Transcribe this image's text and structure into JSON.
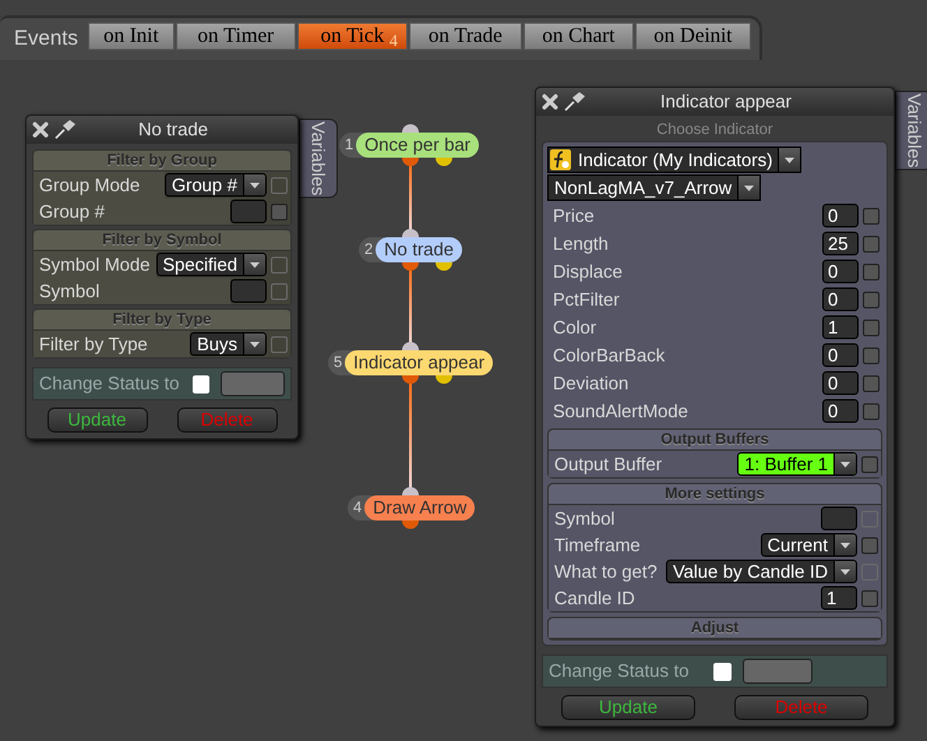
{
  "events": {
    "label": "Events",
    "tabs": [
      {
        "label": "on Init",
        "selected": false
      },
      {
        "label": "on Timer",
        "selected": false
      },
      {
        "label": "on Tick",
        "selected": true,
        "badge": "4"
      },
      {
        "label": "on Trade",
        "selected": false
      },
      {
        "label": "on Chart",
        "selected": false
      },
      {
        "label": "on Deinit",
        "selected": false
      }
    ]
  },
  "nodes": [
    {
      "number": "1",
      "label": "Once per bar",
      "color": "#a8e07c",
      "secondary_output": true
    },
    {
      "number": "2",
      "label": "No trade",
      "color": "#b3cdfb",
      "secondary_output": true
    },
    {
      "number": "5",
      "label": "Indicator appear",
      "color": "#fcd870",
      "secondary_output": true
    },
    {
      "number": "4",
      "label": "Draw Arrow",
      "color": "#f7804f",
      "secondary_output": false
    }
  ],
  "panels": [
    {
      "title": "No trade",
      "side_tab": "Variables",
      "sections": [
        {
          "heading": "Filter by Group",
          "rows": [
            {
              "kind": "select",
              "label": "Group Mode",
              "value": "Group #",
              "toggle_enabled": false
            },
            {
              "kind": "input",
              "label": "Group #",
              "toggle_enabled": true
            }
          ]
        },
        {
          "heading": "Filter by Symbol",
          "rows": [
            {
              "kind": "select",
              "label": "Symbol Mode",
              "value": "Specified",
              "toggle_enabled": false
            },
            {
              "kind": "input",
              "label": "Symbol",
              "toggle_enabled": false
            }
          ]
        },
        {
          "heading": "Filter by Type",
          "rows": [
            {
              "kind": "select",
              "label": "Filter by Type",
              "value": "Buys",
              "toggle_enabled": false
            }
          ]
        }
      ],
      "status": {
        "label": "Change Status to",
        "checked": false
      },
      "buttons": [
        {
          "label": "Update",
          "color": "#3db83d"
        },
        {
          "label": "Delete",
          "color": "#dd0000"
        }
      ]
    },
    {
      "title": "Indicator appear",
      "side_tab": "Variables",
      "chooser": {
        "heading": "Choose Indicator",
        "pickers": [
          {
            "kind": "category",
            "value": "Indicator (My Indicators)"
          },
          {
            "kind": "plain",
            "value": "NonLagMA_v7_Arrow"
          }
        ],
        "rows": [
          {
            "kind": "input",
            "label": "Price",
            "value": "0",
            "toggle_enabled": true
          },
          {
            "kind": "input",
            "label": "Length",
            "value": "25",
            "toggle_enabled": true
          },
          {
            "kind": "input",
            "label": "Displace",
            "value": "0",
            "toggle_enabled": true
          },
          {
            "kind": "input",
            "label": "PctFilter",
            "value": "0",
            "toggle_enabled": true
          },
          {
            "kind": "input",
            "label": "Color",
            "value": "1",
            "toggle_enabled": true
          },
          {
            "kind": "input",
            "label": "ColorBarBack",
            "value": "0",
            "toggle_enabled": true
          },
          {
            "kind": "input",
            "label": "Deviation",
            "value": "0",
            "toggle_enabled": true
          },
          {
            "kind": "input",
            "label": "SoundAlertMode",
            "value": "0",
            "toggle_enabled": true
          }
        ]
      },
      "sections": [
        {
          "heading": "Output Buffers",
          "rows": [
            {
              "kind": "select",
              "label": "Output Buffer",
              "value": "1: Buffer 1",
              "highlighted": true,
              "toggle_enabled": true
            }
          ]
        },
        {
          "heading": "More settings",
          "rows": [
            {
              "kind": "input",
              "label": "Symbol",
              "toggle_enabled": false
            },
            {
              "kind": "select",
              "label": "Timeframe",
              "value": "Current",
              "toggle_enabled": true
            },
            {
              "kind": "select",
              "label": "What to get?",
              "value": "Value by Candle ID",
              "toggle_enabled": false
            },
            {
              "kind": "input",
              "label": "Candle ID",
              "value": "1",
              "toggle_enabled": true
            }
          ]
        },
        {
          "heading": "Adjust"
        }
      ],
      "status": {
        "label": "Change Status to",
        "checked": false
      },
      "buttons": [
        {
          "label": "Update",
          "color": "#3db83d"
        },
        {
          "label": "Delete",
          "color": "#dd0000"
        }
      ]
    }
  ]
}
